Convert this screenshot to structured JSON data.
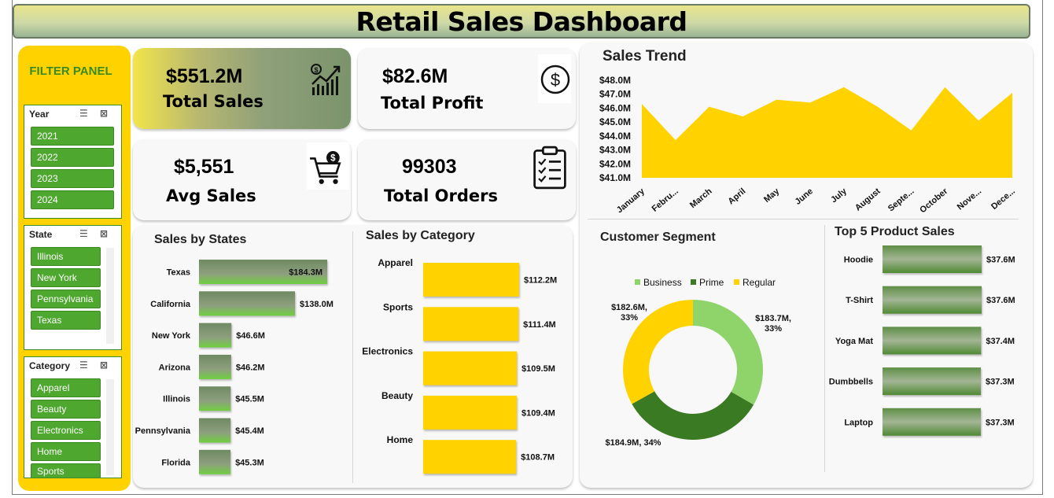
{
  "title": "Retail Sales Dashboard",
  "filter_panel": {
    "title": "FILTER PANEL",
    "year": {
      "label": "Year",
      "items": [
        "2021",
        "2022",
        "2023",
        "2024"
      ]
    },
    "state": {
      "label": "State",
      "items": [
        "Illinois",
        "New York",
        "Pennsylvania",
        "Texas"
      ]
    },
    "category": {
      "label": "Category",
      "items": [
        "Apparel",
        "Beauty",
        "Electronics",
        "Home",
        "Sports"
      ]
    }
  },
  "kpis": {
    "total_sales": {
      "value": "$551.2M",
      "label": "Total Sales"
    },
    "total_profit": {
      "value": "$82.6M",
      "label": "Total Profit"
    },
    "avg_sales": {
      "value": "$5,551",
      "label": "Avg Sales"
    },
    "total_orders": {
      "value": "99303",
      "label": "Total Orders"
    }
  },
  "colors": {
    "yellow": "#ffd200",
    "green": "#4ea72e",
    "dark_green": "#3a7a22",
    "light_green": "#8fd46a",
    "bar_green": "#7d9a70"
  },
  "chart_data": [
    {
      "type": "area",
      "title": "Sales Trend",
      "categories": [
        "January",
        "Febru...",
        "March",
        "April",
        "May",
        "June",
        "July",
        "August",
        "Septe...",
        "October",
        "Nove...",
        "Dece..."
      ],
      "values": [
        46.3,
        43.7,
        46.1,
        45.4,
        46.6,
        46.4,
        47.5,
        46.1,
        44.4,
        47.5,
        45.1,
        47.1
      ],
      "yticks": [
        "$41.0M",
        "$42.0M",
        "$43.0M",
        "$44.0M",
        "$45.0M",
        "$46.0M",
        "$47.0M",
        "$48.0M"
      ],
      "ylim": [
        41,
        48
      ]
    },
    {
      "type": "bar",
      "title": "Sales by States",
      "categories": [
        "Texas",
        "California",
        "New York",
        "Arizona",
        "Illinois",
        "Pennsylvania",
        "Florida"
      ],
      "values": [
        184.3,
        138.0,
        46.6,
        46.2,
        45.5,
        45.4,
        45.3
      ],
      "labels": [
        "$184.3M",
        "$138.0M",
        "$46.6M",
        "$46.2M",
        "$45.5M",
        "$45.4M",
        "$45.3M"
      ]
    },
    {
      "type": "bar",
      "title": "Sales by Category",
      "categories": [
        "Apparel",
        "Sports",
        "Electronics",
        "Beauty",
        "Home"
      ],
      "values": [
        112.2,
        111.4,
        109.5,
        109.4,
        108.7
      ],
      "labels": [
        "$112.2M",
        "$111.4M",
        "$109.5M",
        "$109.4M",
        "$108.7M"
      ]
    },
    {
      "type": "pie",
      "title": "Customer Segment",
      "legend": [
        "Business",
        "Prime",
        "Regular"
      ],
      "values": [
        183.7,
        184.9,
        182.6
      ],
      "labels": [
        "$183.7M,\n33%",
        "$184.9M, 34%",
        "$182.6M,\n33%"
      ]
    },
    {
      "type": "bar",
      "title": "Top 5 Product Sales",
      "categories": [
        "Hoodie",
        "T-Shirt",
        "Yoga Mat",
        "Dumbbells",
        "Laptop"
      ],
      "values": [
        37.6,
        37.6,
        37.4,
        37.3,
        37.3
      ],
      "labels": [
        "$37.6M",
        "$37.6M",
        "$37.4M",
        "$37.3M",
        "$37.3M"
      ]
    }
  ]
}
